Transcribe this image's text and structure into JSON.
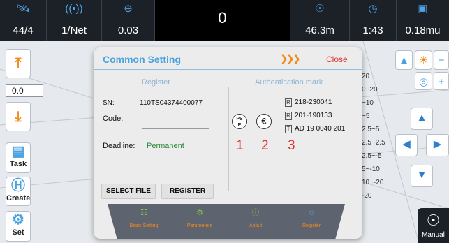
{
  "status_bar": [
    {
      "icon": "satellite-icon",
      "value": "44/4"
    },
    {
      "icon": "antenna-icon",
      "value": "1/Net"
    },
    {
      "icon": "target-icon",
      "value": "0.03"
    },
    {
      "icon": "none",
      "value": "0"
    },
    {
      "icon": "altitude-icon",
      "value": "46.3m"
    },
    {
      "icon": "clock-icon",
      "value": "1:43"
    },
    {
      "icon": "battery-icon",
      "value": "0.18mu"
    }
  ],
  "left_toolbar": {
    "value_field": "0.0",
    "task_label": "Task",
    "create_label": "Create",
    "set_label": "Set"
  },
  "right_list": [
    "20",
    "0~20",
    "~10",
    "~5",
    "2.5~5",
    "2.5~2.5",
    "2.5~-5",
    "5~-10",
    "10~-20",
    "-20"
  ],
  "manual_label": "Manual",
  "dialog": {
    "title": "Common Setting",
    "more_glyph": "❯❯❯",
    "close_label": "Close",
    "register": {
      "heading": "Register",
      "sn_label": "SN:",
      "sn_value": "110TS04374400077",
      "code_label": "Code:",
      "deadline_label": "Deadline:",
      "deadline_value": "Permanent",
      "select_file_label": "SELECT FILE",
      "register_label": "REGISTER"
    },
    "auth": {
      "heading": "Authentication mark",
      "pse_label": "PS\nE",
      "certs": [
        {
          "box": "R",
          "value": "218-230041"
        },
        {
          "box": "R",
          "value": "201-190133"
        },
        {
          "box": "T",
          "value": "AD 19 0040 201"
        }
      ],
      "numbers": [
        "1",
        "2",
        "3"
      ]
    },
    "tabs": [
      {
        "icon": "grid-icon",
        "label": "Basic Setting"
      },
      {
        "icon": "gear-icon",
        "label": "Parameters"
      },
      {
        "icon": "info-icon",
        "label": "About"
      },
      {
        "icon": "person-icon",
        "label": "Register"
      }
    ]
  },
  "colors": {
    "accent": "#4aa3df",
    "warning": "#f08a1c",
    "close": "#e0322d",
    "green": "#2d8a3e"
  }
}
